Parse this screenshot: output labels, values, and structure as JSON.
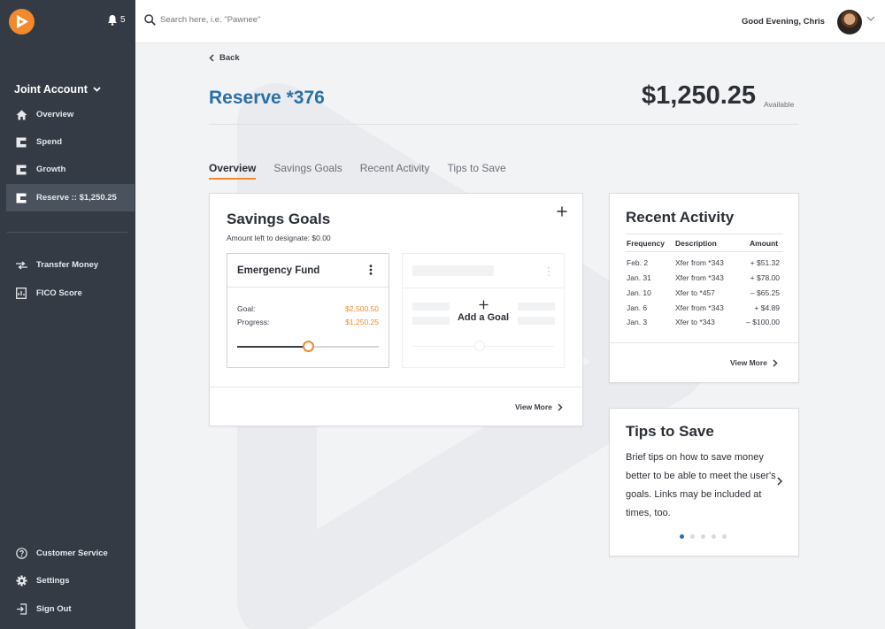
{
  "sidebar": {
    "notification_count": "5",
    "account_title": "Joint Account",
    "items": [
      {
        "label": "Overview"
      },
      {
        "label": "Spend"
      },
      {
        "label": "Growth"
      },
      {
        "label": "Reserve :: $1,250.25"
      },
      {
        "label": "Transfer Money"
      },
      {
        "label": "FICO Score"
      },
      {
        "label": "Customer Service"
      },
      {
        "label": "Settings"
      },
      {
        "label": "Sign Out"
      }
    ]
  },
  "topbar": {
    "search_placeholder": "Search here, i.e. \"Pawnee\"",
    "greeting": "Good Evening, Chris"
  },
  "page": {
    "back_label": "Back",
    "title": "Reserve *376",
    "balance": "$1,250.25",
    "balance_label": "Available",
    "tabs": [
      "Overview",
      "Savings Goals",
      "Recent Activity",
      "Tips to Save"
    ]
  },
  "savings_goals": {
    "title": "Savings Goals",
    "subtitle": "Amount left to designate: $0.00",
    "goal": {
      "name": "Emergency Fund",
      "goal_label": "Goal:",
      "goal_value": "$2,500.50",
      "progress_label": "Progress:",
      "progress_value": "$1,250.25",
      "progress_fraction": 0.5
    },
    "add_goal_label": "Add a Goal",
    "view_more": "View More"
  },
  "recent_activity": {
    "title": "Recent Activity",
    "columns": [
      "Frequency",
      "Description",
      "Amount"
    ],
    "rows": [
      {
        "date": "Feb. 2",
        "desc": "Xfer from *343",
        "amount": "+ $51.32"
      },
      {
        "date": "Jan. 31",
        "desc": "Xfer from *343",
        "amount": "+ $78.00"
      },
      {
        "date": "Jan. 10",
        "desc": "Xfer to *457",
        "amount": "– $65.25"
      },
      {
        "date": "Jan. 6",
        "desc": "Xfer from *343",
        "amount": "+ $4.89"
      },
      {
        "date": "Jan. 3",
        "desc": "Xfer to *343",
        "amount": "– $100.00"
      }
    ],
    "view_more": "View More"
  },
  "tips": {
    "title": "Tips to Save",
    "text": "Brief tips on how to save money better to be able to meet the user's goals. Links may be included at times, too.",
    "dot_count": 5,
    "active_dot": 0
  },
  "colors": {
    "accent": "#f08a2c",
    "brand_blue": "#2a6fa8",
    "sidebar": "#343b45"
  }
}
